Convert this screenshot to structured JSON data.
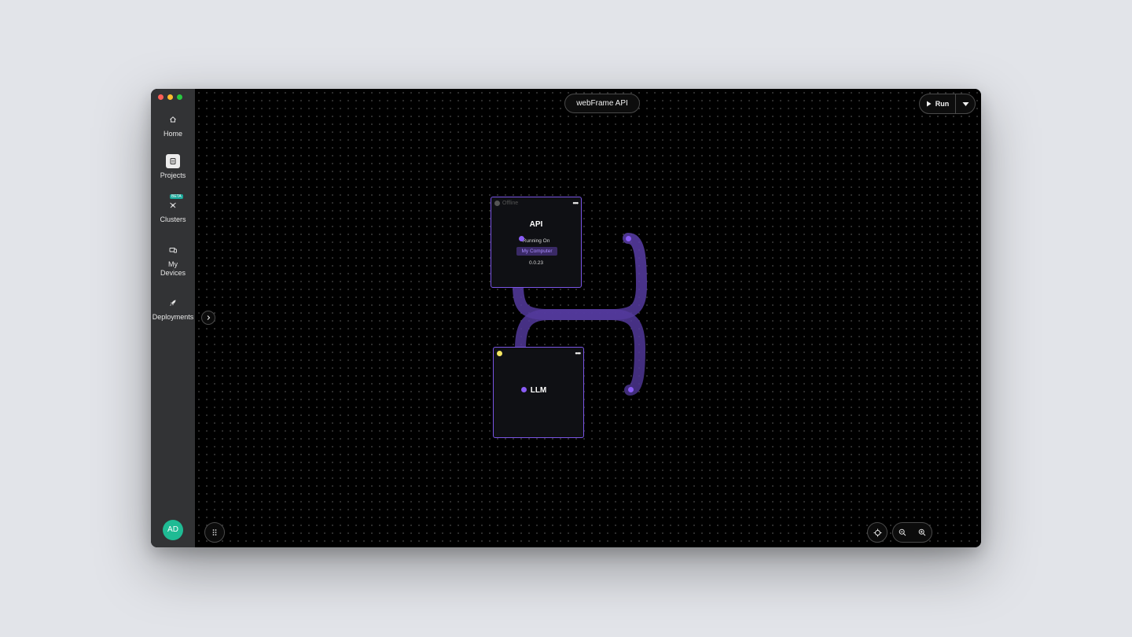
{
  "sidebar": {
    "items": [
      {
        "label": "Home",
        "icon": "home-icon"
      },
      {
        "label": "Projects",
        "icon": "projects-icon"
      },
      {
        "label": "Clusters",
        "icon": "clusters-icon",
        "badge": "BETA"
      },
      {
        "label": "My Devices",
        "icon": "devices-icon"
      },
      {
        "label": "Deployments",
        "icon": "rocket-icon"
      }
    ],
    "avatar_initials": "AD"
  },
  "header": {
    "title": "webFrame API",
    "run_label": "Run"
  },
  "nodes": {
    "api": {
      "status": "Offline",
      "name": "API",
      "running_on_label": "Running On",
      "device": "My Computer",
      "version": "0.0.23"
    },
    "llm": {
      "name": "LLM"
    }
  },
  "colors": {
    "accent": "#8a5cf6",
    "node_border": "#7a55e6",
    "avatar": "#1fbb94",
    "beta_badge": "#1aa89a",
    "offline_dot": "#555555",
    "llm_status_dot": "#f5e663"
  }
}
